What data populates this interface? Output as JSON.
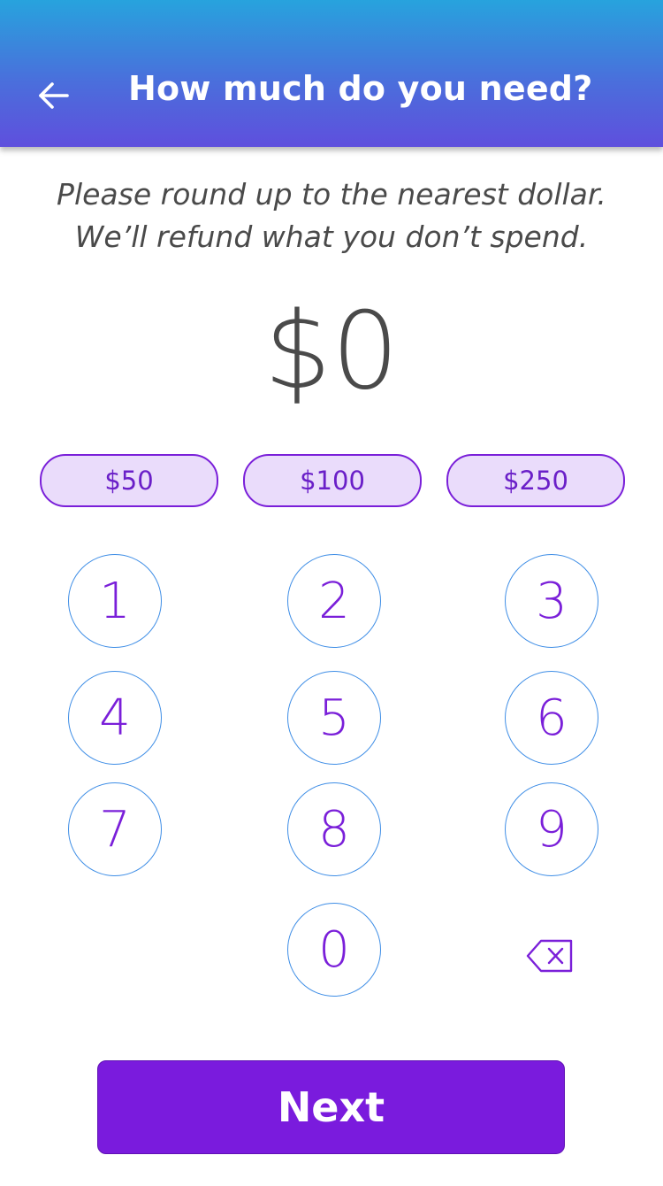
{
  "header": {
    "title": "How much do you need?",
    "back_icon": "arrow-left-icon"
  },
  "instructions": {
    "line1": "Please round up to the nearest dollar.",
    "line2": "We’ll refund what you don’t spend."
  },
  "amount": {
    "display": "$0"
  },
  "presets": [
    {
      "label": "$50"
    },
    {
      "label": "$100"
    },
    {
      "label": "$250"
    }
  ],
  "keypad": {
    "keys": [
      "1",
      "2",
      "3",
      "4",
      "5",
      "6",
      "7",
      "8",
      "9",
      "0"
    ],
    "backspace_icon": "backspace-icon"
  },
  "footer": {
    "next_label": "Next"
  },
  "colors": {
    "header_gradient_top": "#27a3dd",
    "header_gradient_bottom": "#5f4fdd",
    "accent_purple": "#7a1bdd",
    "preset_fill": "#eadcfb",
    "key_border": "#3f8ee6",
    "text_gray": "#4a4a4a"
  }
}
